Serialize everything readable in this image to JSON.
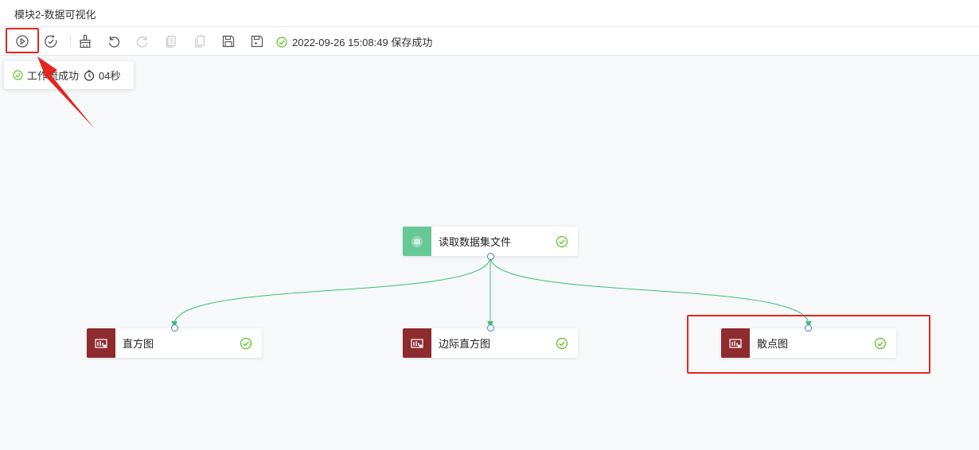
{
  "window": {
    "title": "模块2-数据可视化"
  },
  "toolbar": {
    "buttons": [
      "run-icon",
      "check-run-icon",
      "brush-icon",
      "undo-icon",
      "redo-icon",
      "copy-icon",
      "paste-icon",
      "save-icon",
      "save-as-icon"
    ],
    "save_status": "2022-09-26 15:08:49 保存成功"
  },
  "run_popup": {
    "status": "工作流成功",
    "duration": "04秒"
  },
  "nodes": {
    "source": {
      "label": "读取数据集文件",
      "icon": "dataset-icon"
    },
    "histogram": {
      "label": "直方图",
      "icon": "chart-icon"
    },
    "marginal_histogram": {
      "label": "边际直方图",
      "icon": "chart-icon"
    },
    "scatter": {
      "label": "散点图",
      "icon": "chart-icon"
    }
  },
  "colors": {
    "accent_red": "#e5251e",
    "success_green": "#52c41a",
    "source_node": "#66c897",
    "viz_node": "#8e2b2e",
    "edge": "#3cc07a",
    "port": "#3a7bd5"
  }
}
